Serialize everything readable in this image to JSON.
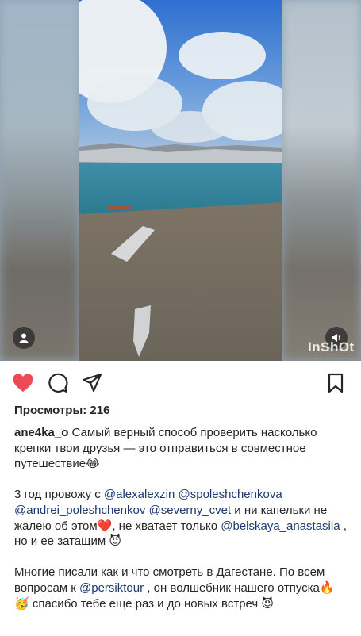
{
  "media": {
    "watermark": "InShOt",
    "play_icon": "user-icon",
    "sound_icon": "speaker-icon"
  },
  "actions": {
    "like_icon": "heart-icon",
    "like_color": "#ed4956",
    "comment_icon": "comment-icon",
    "share_icon": "send-icon",
    "save_icon": "bookmark-icon"
  },
  "views": "Просмотры: 216",
  "caption": {
    "username": "ane4ka_o",
    "p1_text": " Самый верный способ проверить насколько крепки твои друзья — это отправиться в совместное путешествие😂",
    "p2_a": "3 год провожу с ",
    "p2_m1": "@alexalexzin",
    "p2_s1": " ",
    "p2_m2": "@spoleshchenkova",
    "p2_s2": " ",
    "p2_m3": "@andrei_poleshchenkov",
    "p2_s3": " ",
    "p2_m4": "@severny_cvet",
    "p2_b": "  и ни капельки не жалею об этом❤️, не хватает только ",
    "p2_m5": "@belskaya_anastasiia",
    "p2_c": " , но и ее затащим 😈",
    "p3_a": "Многие писали как и что смотреть в Дагестане. По всем вопросам к ",
    "p3_m1": "@persiktour",
    "p3_b": " , он волшебник нашего отпуска🔥🥳 спасибо тебе еще раз и до новых встреч 😈"
  }
}
